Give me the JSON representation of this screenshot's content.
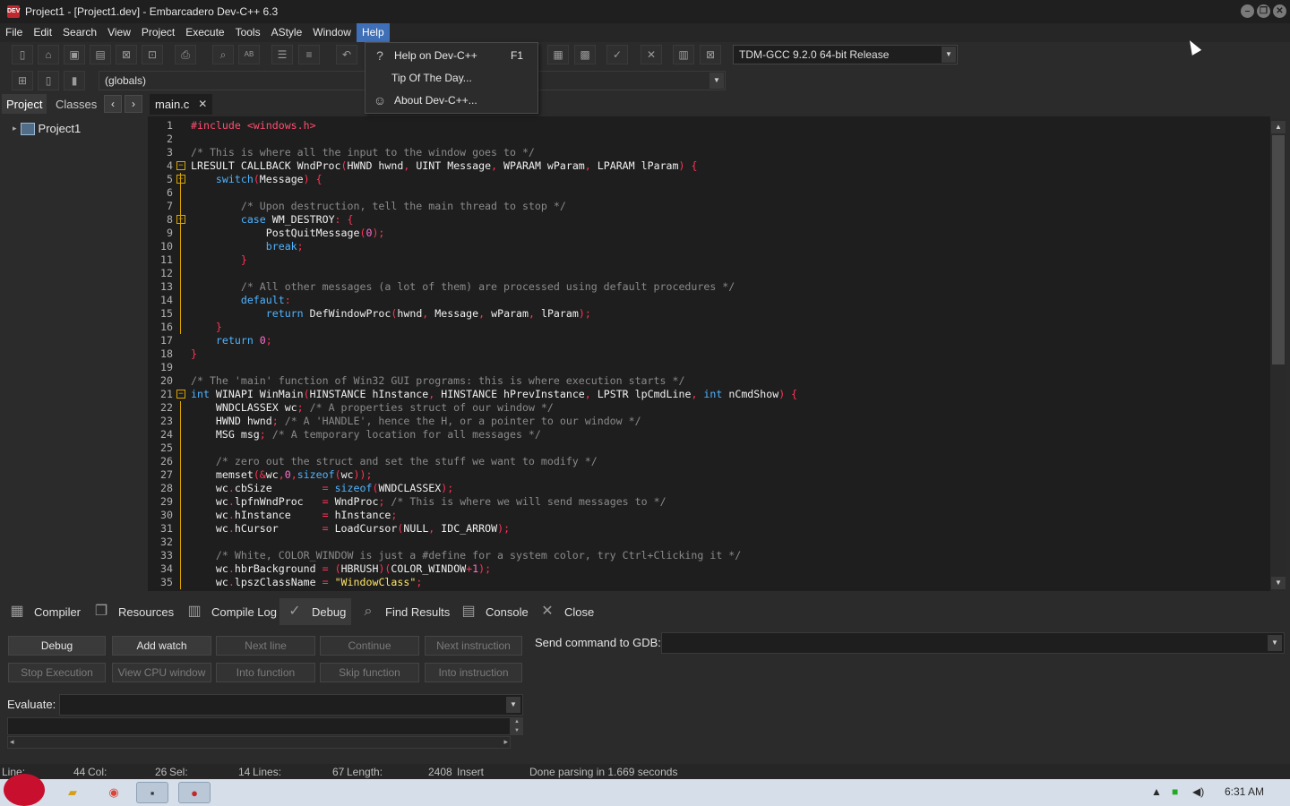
{
  "window": {
    "title": "Project1 - [Project1.dev] - Embarcadero Dev-C++ 6.3",
    "logo_text": "DEV",
    "controls": {
      "minimize": "–",
      "restore": "❐",
      "close": "✕"
    }
  },
  "menubar": {
    "items": [
      "File",
      "Edit",
      "Search",
      "View",
      "Project",
      "Execute",
      "Tools",
      "AStyle",
      "Window",
      "Help"
    ],
    "active_index": 9
  },
  "help_menu": {
    "items": [
      {
        "label": "Help on Dev-C++",
        "shortcut": "F1",
        "icon": "help-icon"
      },
      {
        "label": "Tip Of The Day...",
        "shortcut": "",
        "icon": ""
      },
      {
        "label": "About Dev-C++...",
        "shortcut": "",
        "icon": "smiley-icon"
      }
    ]
  },
  "toolbar": {
    "compiler_select": "TDM-GCC 9.2.0 64-bit Release",
    "scope_select": "(globals)"
  },
  "left_panel": {
    "tabs": [
      "Project",
      "Classes"
    ],
    "active_tab": "Project",
    "tree_root": "Project1"
  },
  "editor": {
    "file_tab": "main.c",
    "line_numbers": [
      "1",
      "2",
      "3",
      "4",
      "5",
      "6",
      "7",
      "8",
      "9",
      "10",
      "11",
      "12",
      "13",
      "14",
      "15",
      "16",
      "17",
      "18",
      "19",
      "20",
      "21",
      "22",
      "23",
      "24",
      "25",
      "26",
      "27",
      "28",
      "29",
      "30",
      "31",
      "32",
      "33",
      "34",
      "35"
    ],
    "fold_lines": [
      4,
      5,
      8,
      21
    ],
    "colors": {
      "keyword": "#4fb3ff",
      "comment": "#8a8a8a",
      "preprocessor": "#ff4d6d",
      "number": "#ff6fcf",
      "string": "#ffe566",
      "symbol": "#ff3355",
      "identifier": "#f0f0f0",
      "fold": "#d9a400"
    },
    "lines": [
      [
        [
          "pp",
          "#include <windows.h>"
        ]
      ],
      [],
      [
        [
          "cm",
          "/* This is where all the input to the window goes to */"
        ]
      ],
      [
        [
          "id",
          "LRESULT CALLBACK WndProc"
        ],
        [
          "sym",
          "("
        ],
        [
          "id",
          "HWND hwnd"
        ],
        [
          "sym",
          ", "
        ],
        [
          "id",
          "UINT Message"
        ],
        [
          "sym",
          ", "
        ],
        [
          "id",
          "WPARAM wParam"
        ],
        [
          "sym",
          ", "
        ],
        [
          "id",
          "LPARAM lParam"
        ],
        [
          "sym",
          ") {"
        ]
      ],
      [
        [
          "id",
          "    "
        ],
        [
          "kw",
          "switch"
        ],
        [
          "sym",
          "("
        ],
        [
          "id",
          "Message"
        ],
        [
          "sym",
          ") {"
        ]
      ],
      [],
      [
        [
          "cm",
          "        /* Upon destruction, tell the main thread to stop */"
        ]
      ],
      [
        [
          "id",
          "        "
        ],
        [
          "kw",
          "case"
        ],
        [
          "id",
          " WM_DESTROY"
        ],
        [
          "sym",
          ": {"
        ]
      ],
      [
        [
          "id",
          "            PostQuitMessage"
        ],
        [
          "sym",
          "("
        ],
        [
          "num",
          "0"
        ],
        [
          "sym",
          ");"
        ]
      ],
      [
        [
          "id",
          "            "
        ],
        [
          "kw",
          "break"
        ],
        [
          "sym",
          ";"
        ]
      ],
      [
        [
          "sym",
          "        }"
        ]
      ],
      [],
      [
        [
          "cm",
          "        /* All other messages (a lot of them) are processed using default procedures */"
        ]
      ],
      [
        [
          "id",
          "        "
        ],
        [
          "kw",
          "default"
        ],
        [
          "sym",
          ":"
        ]
      ],
      [
        [
          "id",
          "            "
        ],
        [
          "kw",
          "return"
        ],
        [
          "id",
          " DefWindowProc"
        ],
        [
          "sym",
          "("
        ],
        [
          "id",
          "hwnd"
        ],
        [
          "sym",
          ", "
        ],
        [
          "id",
          "Message"
        ],
        [
          "sym",
          ", "
        ],
        [
          "id",
          "wParam"
        ],
        [
          "sym",
          ", "
        ],
        [
          "id",
          "lParam"
        ],
        [
          "sym",
          ");"
        ]
      ],
      [
        [
          "sym",
          "    }"
        ]
      ],
      [
        [
          "id",
          "    "
        ],
        [
          "kw",
          "return"
        ],
        [
          "id",
          " "
        ],
        [
          "num",
          "0"
        ],
        [
          "sym",
          ";"
        ]
      ],
      [
        [
          "sym",
          "}"
        ]
      ],
      [],
      [
        [
          "cm",
          "/* The 'main' function of Win32 GUI programs: this is where execution starts */"
        ]
      ],
      [
        [
          "kw",
          "int"
        ],
        [
          "id",
          " WINAPI WinMain"
        ],
        [
          "sym",
          "("
        ],
        [
          "id",
          "HINSTANCE hInstance"
        ],
        [
          "sym",
          ", "
        ],
        [
          "id",
          "HINSTANCE hPrevInstance"
        ],
        [
          "sym",
          ", "
        ],
        [
          "id",
          "LPSTR lpCmdLine"
        ],
        [
          "sym",
          ", "
        ],
        [
          "kw",
          "int"
        ],
        [
          "id",
          " nCmdShow"
        ],
        [
          "sym",
          ") {"
        ]
      ],
      [
        [
          "id",
          "    WNDCLASSEX wc"
        ],
        [
          "sym",
          "; "
        ],
        [
          "cm",
          "/* A properties struct of our window */"
        ]
      ],
      [
        [
          "id",
          "    HWND hwnd"
        ],
        [
          "sym",
          "; "
        ],
        [
          "cm",
          "/* A 'HANDLE', hence the H, or a pointer to our window */"
        ]
      ],
      [
        [
          "id",
          "    MSG msg"
        ],
        [
          "sym",
          "; "
        ],
        [
          "cm",
          "/* A temporary location for all messages */"
        ]
      ],
      [],
      [
        [
          "cm",
          "    /* zero out the struct and set the stuff we want to modify */"
        ]
      ],
      [
        [
          "id",
          "    memset"
        ],
        [
          "sym",
          "(&"
        ],
        [
          "id",
          "wc"
        ],
        [
          "sym",
          ","
        ],
        [
          "num",
          "0"
        ],
        [
          "sym",
          ","
        ],
        [
          "kw",
          "sizeof"
        ],
        [
          "sym",
          "("
        ],
        [
          "id",
          "wc"
        ],
        [
          "sym",
          "));"
        ]
      ],
      [
        [
          "id",
          "    wc"
        ],
        [
          "sym",
          "."
        ],
        [
          "id",
          "cbSize        "
        ],
        [
          "sym",
          "= "
        ],
        [
          "kw",
          "sizeof"
        ],
        [
          "sym",
          "("
        ],
        [
          "id",
          "WNDCLASSEX"
        ],
        [
          "sym",
          ");"
        ]
      ],
      [
        [
          "id",
          "    wc"
        ],
        [
          "sym",
          "."
        ],
        [
          "id",
          "lpfnWndProc   "
        ],
        [
          "sym",
          "= "
        ],
        [
          "id",
          "WndProc"
        ],
        [
          "sym",
          "; "
        ],
        [
          "cm",
          "/* This is where we will send messages to */"
        ]
      ],
      [
        [
          "id",
          "    wc"
        ],
        [
          "sym",
          "."
        ],
        [
          "id",
          "hInstance     "
        ],
        [
          "sym",
          "= "
        ],
        [
          "id",
          "hInstance"
        ],
        [
          "sym",
          ";"
        ]
      ],
      [
        [
          "id",
          "    wc"
        ],
        [
          "sym",
          "."
        ],
        [
          "id",
          "hCursor       "
        ],
        [
          "sym",
          "= "
        ],
        [
          "id",
          "LoadCursor"
        ],
        [
          "sym",
          "("
        ],
        [
          "id",
          "NULL"
        ],
        [
          "sym",
          ", "
        ],
        [
          "id",
          "IDC_ARROW"
        ],
        [
          "sym",
          ");"
        ]
      ],
      [],
      [
        [
          "cm",
          "    /* White, COLOR_WINDOW is just a #define for a system color, try Ctrl+Clicking it */"
        ]
      ],
      [
        [
          "id",
          "    wc"
        ],
        [
          "sym",
          "."
        ],
        [
          "id",
          "hbrBackground "
        ],
        [
          "sym",
          "= ("
        ],
        [
          "id",
          "HBRUSH"
        ],
        [
          "sym",
          ")("
        ],
        [
          "id",
          "COLOR_WINDOW"
        ],
        [
          "sym",
          "+"
        ],
        [
          "num",
          "1"
        ],
        [
          "sym",
          ");"
        ]
      ],
      [
        [
          "id",
          "    wc"
        ],
        [
          "sym",
          "."
        ],
        [
          "id",
          "lpszClassName "
        ],
        [
          "sym",
          "= "
        ],
        [
          "str",
          "\"WindowClass\""
        ],
        [
          "sym",
          ";"
        ]
      ]
    ]
  },
  "bottom_tabs": {
    "items": [
      {
        "label": "Compiler",
        "icon": "grid-icon"
      },
      {
        "label": "Resources",
        "icon": "resources-icon"
      },
      {
        "label": "Compile Log",
        "icon": "chart-icon"
      },
      {
        "label": "Debug",
        "icon": "check-icon"
      },
      {
        "label": "Find Results",
        "icon": "find-icon"
      },
      {
        "label": "Console",
        "icon": "console-icon"
      },
      {
        "label": "Close",
        "icon": "close-icon"
      }
    ],
    "active": "Debug"
  },
  "debug": {
    "buttons_row1": [
      "Debug",
      "Add watch",
      "Next line",
      "Continue",
      "Next instruction"
    ],
    "buttons_row2": [
      "Stop Execution",
      "View CPU window",
      "Into function",
      "Skip function",
      "Into instruction"
    ],
    "enabled": [
      "Debug",
      "Add watch"
    ],
    "gdb_label": "Send command to GDB:",
    "evaluate_label": "Evaluate:"
  },
  "statusbar": {
    "line_label": "Line:",
    "line_value": "44",
    "col_label": "Col:",
    "col_value": "26",
    "sel_label": "Sel:",
    "sel_value": "14",
    "lines_label": "Lines:",
    "lines_value": "67",
    "length_label": "Length:",
    "length_value": "2408",
    "mode": "Insert",
    "message": "Done parsing in 1.669 seconds"
  },
  "taskbar": {
    "clock": "6:31 AM",
    "apps": [
      "angry-birds-icon",
      "folder-icon",
      "chrome-icon",
      "terminal-icon",
      "devcpp-icon"
    ]
  }
}
